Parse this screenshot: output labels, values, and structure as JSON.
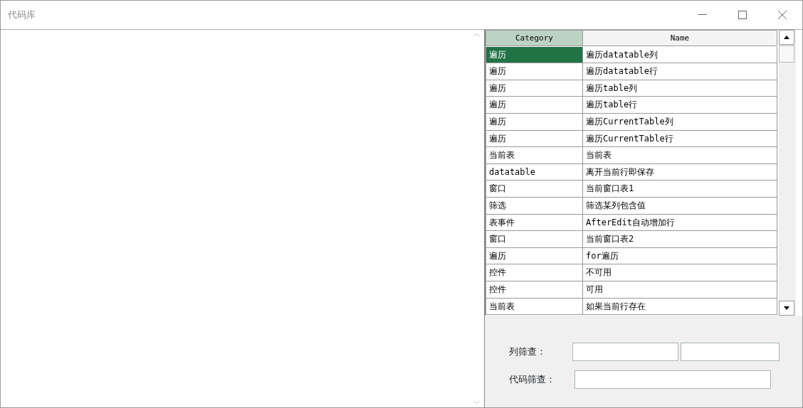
{
  "window": {
    "title": "代码库"
  },
  "table": {
    "columns": [
      {
        "label": "Category",
        "selected": true
      },
      {
        "label": "Name",
        "selected": false
      }
    ],
    "rows": [
      {
        "category": "遍历",
        "name": "遍历datatable列",
        "selected": true
      },
      {
        "category": "遍历",
        "name": "遍历datatable行",
        "selected": false
      },
      {
        "category": "遍历",
        "name": "遍历table列",
        "selected": false
      },
      {
        "category": "遍历",
        "name": "遍历table行",
        "selected": false
      },
      {
        "category": "遍历",
        "name": "遍历CurrentTable列",
        "selected": false
      },
      {
        "category": "遍历",
        "name": "遍历CurrentTable行",
        "selected": false
      },
      {
        "category": "当前表",
        "name": "当前表",
        "selected": false
      },
      {
        "category": "datatable",
        "name": "离开当前行即保存",
        "selected": false
      },
      {
        "category": "窗口",
        "name": "当前窗口表1",
        "selected": false
      },
      {
        "category": "筛选",
        "name": "筛选某列包含值",
        "selected": false
      },
      {
        "category": "表事件",
        "name": "AfterEdit自动增加行",
        "selected": false
      },
      {
        "category": "窗口",
        "name": "当前窗口表2",
        "selected": false
      },
      {
        "category": "遍历",
        "name": "for遍历",
        "selected": false
      },
      {
        "category": "控件",
        "name": "不可用",
        "selected": false
      },
      {
        "category": "控件",
        "name": "可用",
        "selected": false
      },
      {
        "category": "当前表",
        "name": "如果当前行存在",
        "selected": false
      }
    ]
  },
  "filters": {
    "column_filter": {
      "label": "列筛查："
    },
    "code_filter": {
      "label": "代码筛查："
    }
  }
}
